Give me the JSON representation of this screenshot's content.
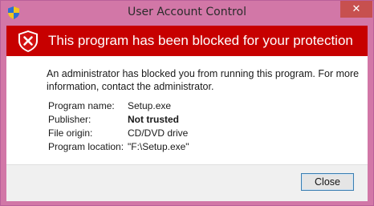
{
  "window": {
    "title": "User Account Control",
    "close_glyph": "✕"
  },
  "banner": {
    "text": "This program has been blocked for your protection",
    "icon": "shield-x-icon",
    "color": "#c70000"
  },
  "message": "An administrator has blocked you from running this program. For more information, contact the administrator.",
  "details": [
    {
      "label": "Program name:",
      "value": "Setup.exe",
      "bold": false
    },
    {
      "label": "Publisher:",
      "value": "Not trusted",
      "bold": true
    },
    {
      "label": "File origin:",
      "value": "CD/DVD drive",
      "bold": false
    },
    {
      "label": "Program location:",
      "value": "\"F:\\Setup.exe\"",
      "bold": false
    }
  ],
  "buttons": {
    "close_label": "Close"
  },
  "colors": {
    "frame": "#d277a7",
    "title_close_bg": "#c7504f"
  }
}
